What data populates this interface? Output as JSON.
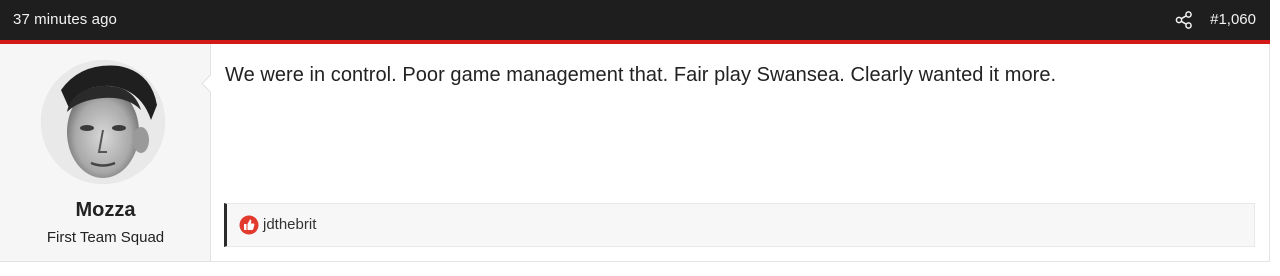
{
  "post": {
    "timestamp": "37 minutes ago",
    "share_icon": "share-icon",
    "post_number": "#1,060",
    "accent_color": "#d41919",
    "header_color": "#1e1e1e"
  },
  "author": {
    "name": "Mozza",
    "title": "First Team Squad",
    "avatar_icon": "avatar-photo"
  },
  "message": {
    "text": "We were in control. Poor game management that. Fair play Swansea. Clearly wanted it more."
  },
  "reactions": {
    "icon": "like-icon",
    "users": "jdthebrit"
  }
}
